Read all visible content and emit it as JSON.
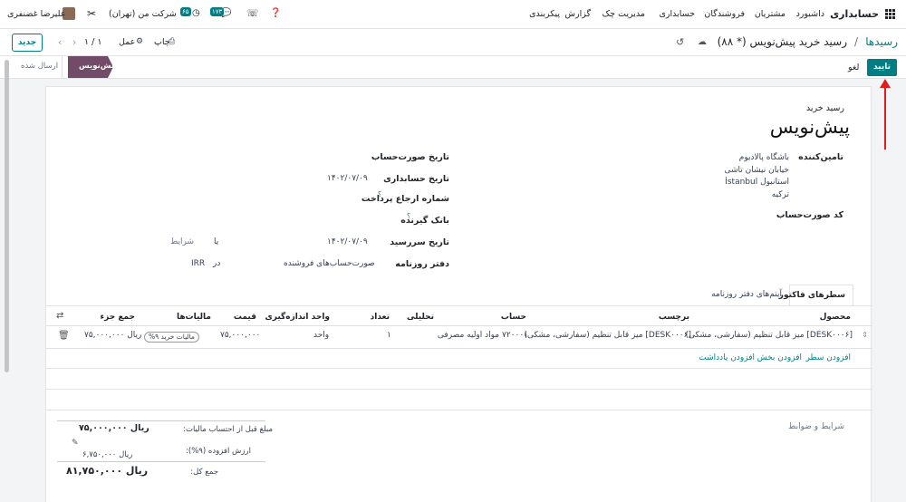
{
  "nav": {
    "brand": "حسابداری",
    "menu": [
      "داشبورد",
      "مشتریان",
      "فروشندگان",
      "حسابداری",
      "مدیریت چک",
      "گزارش",
      "پیکربندی"
    ],
    "company": "شرکت من (تهران)",
    "activity_badge": "۶۵",
    "messages_badge": "۱۷۳",
    "user": "علیرضا غضنفری"
  },
  "control": {
    "breadcrumb_parent": "رسیدها",
    "breadcrumb_sep": "/",
    "breadcrumb_current": "رسید خرید پیش‌نویس (* ۸۸)",
    "print_label": "چاپ",
    "action_label": "عمل",
    "pager": "۱ / ۱",
    "new_label": "جدید"
  },
  "status": {
    "confirm_label": "تایید",
    "cancel_label": "لغو",
    "stage_current": "پیش‌نویس",
    "stage_next": "ارسال شده"
  },
  "form": {
    "doc_type": "رسید خرید",
    "doc_title": "پیش‌نویس",
    "vendor_label": "تامین‌کننده",
    "vendor_name": "باشگاه پالادیوم",
    "vendor_addr1": "خیابان نیشان تاشی",
    "vendor_addr2": "استانبول İstanbul",
    "vendor_addr3": "ترکیه",
    "bill_ref_label": "کد صورت‌حساب",
    "invoice_date_label": "تاریخ صورت‌حساب",
    "accounting_date_label": "تاریخ حسابداری",
    "accounting_date": "۱۴۰۲/۰۷/۰۹",
    "payment_ref_label": "شماره ارجاع پرداخت",
    "bank_label": "بانک گیرنده",
    "due_date_label": "تاریخ سررسید",
    "due_date": "۱۴۰۲/۰۷/۰۹",
    "or_label": "یا",
    "terms_placeholder": "شرایط",
    "journal_label": "دفتر روزنامه",
    "journal_value": "صورت‌حساب‌های فروشنده",
    "in_label": "در",
    "currency": "IRR",
    "help_mark": "؟"
  },
  "tabs": [
    "سطرهای فاکتور",
    "آیتم‌های دفتر روزنامه"
  ],
  "table": {
    "headers": {
      "product": "محصول",
      "label": "برچسب",
      "account": "حساب",
      "analytic": "تحلیلی",
      "qty": "تعداد",
      "uom": "واحد اندازه‌گیری",
      "price": "قیمت",
      "taxes": "مالیات‌ها",
      "subtotal": "جمع جزء"
    },
    "row": {
      "product": "[DESK۰۰۰۶] میز قابل تنظیم (سفارشی، مشکی)",
      "label": "[DESK۰۰۰۶] میز قابل تنظیم (سفارشی، مشکی)",
      "account": "۷۲۰۰۰۱ مواد اولیه مصرفی",
      "qty": "۱",
      "uom": "واحد",
      "price": "۷۵,۰۰۰,۰۰۰",
      "tax": "مالیات خرید ۹%",
      "subtotal": "ریال ۷۵,۰۰۰,۰۰۰"
    },
    "add_line": "افزودن سطر",
    "add_section": "افزودن بخش",
    "add_note": "افزودن یادداشت"
  },
  "footer": {
    "terms_placeholder": "شرایط و ضوابط",
    "untaxed_label": "مبلغ قبل از احتساب مالیات:",
    "untaxed_value": "ریال ۷۵,۰۰۰,۰۰۰",
    "vat_label": "ارزش افزوده (۹%):",
    "vat_value": "ریال ۶,۷۵۰,۰۰۰",
    "total_label": "جمع کل:",
    "total_value": "ریال ۸۱,۷۵۰,۰۰۰"
  },
  "colors": {
    "accent": "#017e84",
    "stage_active": "#714b67",
    "annotation": "#e11d1d"
  }
}
